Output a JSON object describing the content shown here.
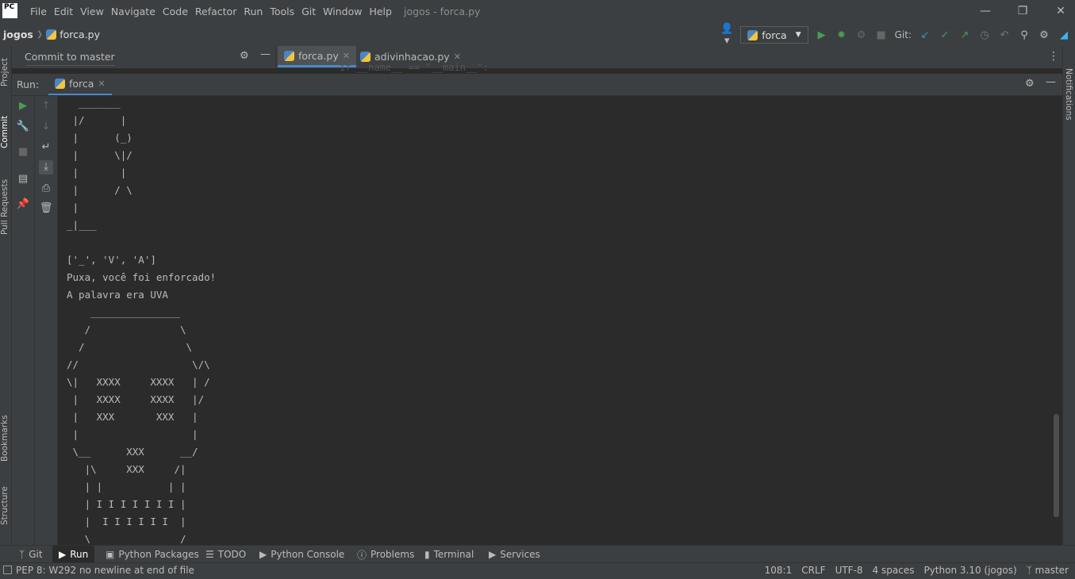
{
  "app": {
    "logo_text": "PC",
    "window_title": "jogos - forca.py"
  },
  "menu": [
    "File",
    "Edit",
    "View",
    "Navigate",
    "Code",
    "Refactor",
    "Run",
    "Tools",
    "Git",
    "Window",
    "Help"
  ],
  "breadcrumb": {
    "project": "jogos",
    "file": "forca.py"
  },
  "toolbar": {
    "run_config": "forca",
    "git_label": "Git:"
  },
  "left_strip": [
    "Project",
    "Commit",
    "Pull Requests",
    "Bookmarks",
    "Structure"
  ],
  "right_strip": [
    "Notifications"
  ],
  "commit_panel": {
    "title": "Commit to master"
  },
  "editor_tabs": [
    {
      "label": "forca.py",
      "active": true
    },
    {
      "label": "adivinhacao.py",
      "active": false
    }
  ],
  "ghost_code": "if __name__ == \"__main__\":",
  "run_window": {
    "label": "Run:",
    "tab": "forca"
  },
  "console_lines": [
    "  _______",
    " |/      |",
    " |      (_)",
    " |      \\|/",
    " |       |",
    " |      / \\",
    " |",
    "_|___",
    "",
    "['_', 'V', 'A']",
    "Puxa, você foi enforcado!",
    "A palavra era UVA",
    "    _______________",
    "   /               \\",
    "  /                 \\",
    "//                   \\/\\",
    "\\|   XXXX     XXXX   | /",
    " |   XXXX     XXXX   |/",
    " |   XXX       XXX   |",
    " |                   |",
    " \\__      XXX      __/",
    "   |\\     XXX     /|",
    "   | |           | |",
    "   | I I I I I I I |",
    "   |  I I I I I I  |",
    "   \\_             _/"
  ],
  "bottom_tabs": [
    {
      "label": "Git",
      "icon": "git-branch-icon",
      "active": false
    },
    {
      "label": "Run",
      "icon": "play-icon",
      "active": true
    },
    {
      "label": "Python Packages",
      "icon": "package-icon",
      "active": false
    },
    {
      "label": "TODO",
      "icon": "list-icon",
      "active": false
    },
    {
      "label": "Python Console",
      "icon": "console-icon",
      "active": false
    },
    {
      "label": "Problems",
      "icon": "info-icon",
      "active": false
    },
    {
      "label": "Terminal",
      "icon": "terminal-icon",
      "active": false
    },
    {
      "label": "Services",
      "icon": "services-icon",
      "active": false
    }
  ],
  "status": {
    "message": "PEP 8: W292 no newline at end of file",
    "position": "108:1",
    "line_sep": "CRLF",
    "encoding": "UTF-8",
    "indent": "4 spaces",
    "interpreter": "Python 3.10 (jogos)",
    "branch": "master"
  },
  "colors": {
    "accent": "#4a88c7",
    "run_green": "#499c54",
    "panel_bg": "#3c3f41",
    "editor_bg": "#2b2b2b"
  }
}
